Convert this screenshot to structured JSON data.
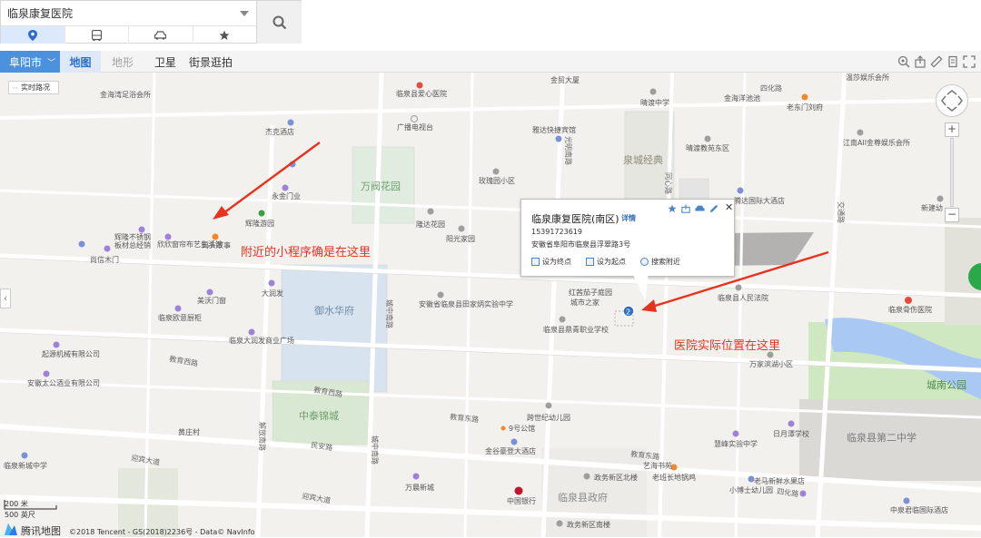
{
  "search": {
    "value": "临泉康复医院",
    "modes": [
      "place-icon",
      "bus-icon",
      "car-icon",
      "star-icon"
    ]
  },
  "toolbar": {
    "city": "阜阳市",
    "map_types": [
      "地图",
      "地形",
      "卫星",
      "街景逛拍"
    ],
    "active_map_type": "地图"
  },
  "traffic_button": "实时路况",
  "colors": {
    "accent": "#4b91dd",
    "annotation": "#e8321e",
    "water": "#a9c8f4",
    "green": "#cfe8c1",
    "block": "#dcdcdc"
  },
  "area_labels": {
    "wanfu": "万阀花园",
    "yushui": "御水华府",
    "zhongtai": "中泰锦城",
    "quancheng": "泉城经典",
    "chengnan": "城南公园",
    "no2_school": "临泉县第二中学",
    "gov": "临泉县政府",
    "huihuang": "辉隆游园"
  },
  "roads": {
    "jiaoyu_w": "教育西路",
    "jiaoyu_w2": "教育西路",
    "jiaoyu_e": "教育东路",
    "jiaoyu_e2": "教育东路",
    "yingbin": "迎宾大道",
    "yingbin2": "迎宾大道",
    "minan": "民安路",
    "jiefang": "解放南路",
    "chengzhong": "城中南路",
    "chengzhong2": "城中南路",
    "guangming": "光明南路",
    "jiaotong": "交通路",
    "tongshen": "同心路",
    "sihua": "四化路",
    "jinfu": "金贸大厦"
  },
  "pois": [
    "临泉县爱心医院",
    "广播电视台",
    "杰克酒店",
    "永金门业",
    "辉隆不锈钢",
    "板材总经销",
    "欣欣窗帘布艺生活馆",
    "码头故事",
    "尚信木门",
    "美沃门窗",
    "大润发",
    "临泉欧意厨柜",
    "临泉大润发商业广场",
    "起源机械有限公司",
    "安徽太公酒业有限公司",
    "临泉新城中学",
    "金谷豪登大酒店",
    "中国银行",
    "万晨新城",
    "政务新区北楼",
    "政务新区南楼",
    "老班长地锅鸡",
    "艺海书苑",
    "小博士幼儿园",
    "老马新鲜水果店",
    "中泉君临国际酒店",
    "慧峰实验中学",
    "日月潭学校",
    "跨世纪幼儿园",
    "9号公馆",
    "安徽省临泉县田家炳实验中学",
    "临泉县鼎青职业学校",
    "红茜茄子庭园",
    "城市之家",
    "临泉县人民法院",
    "万家滨湖小区",
    "临泉骨伤医院",
    "新建幼",
    "江南All金尊娱乐会所",
    "晴渡教苑东区",
    "老东门刘府",
    "金海洋池池",
    "晴渡中学",
    "温莎娱乐会所",
    "金贸大厦",
    "雅达快捷宾馆",
    "玫瑰园小区",
    "隆达花园",
    "阳光家园",
    "黄庄村",
    "金海湾足浴会所",
    "腾达国际大酒店"
  ],
  "popup": {
    "title": "临泉康复医院(南区)",
    "detail_link": "详情",
    "phone": "15391723619",
    "address": "安徽省阜阳市临泉县浮翠路3号",
    "actions": [
      "设为终点",
      "设为起点",
      "搜索附近"
    ],
    "marker_number": "2"
  },
  "annotations": {
    "left": "附近的小程序确是在这里",
    "right": "医院实际位置在这里"
  },
  "scale": {
    "metric": "200 米",
    "imperial": "500 英尺"
  },
  "brand": {
    "name": "腾讯地图",
    "copyright": "©2018 Tencent - GS(2018)2236号 - Data© NavInfo"
  }
}
